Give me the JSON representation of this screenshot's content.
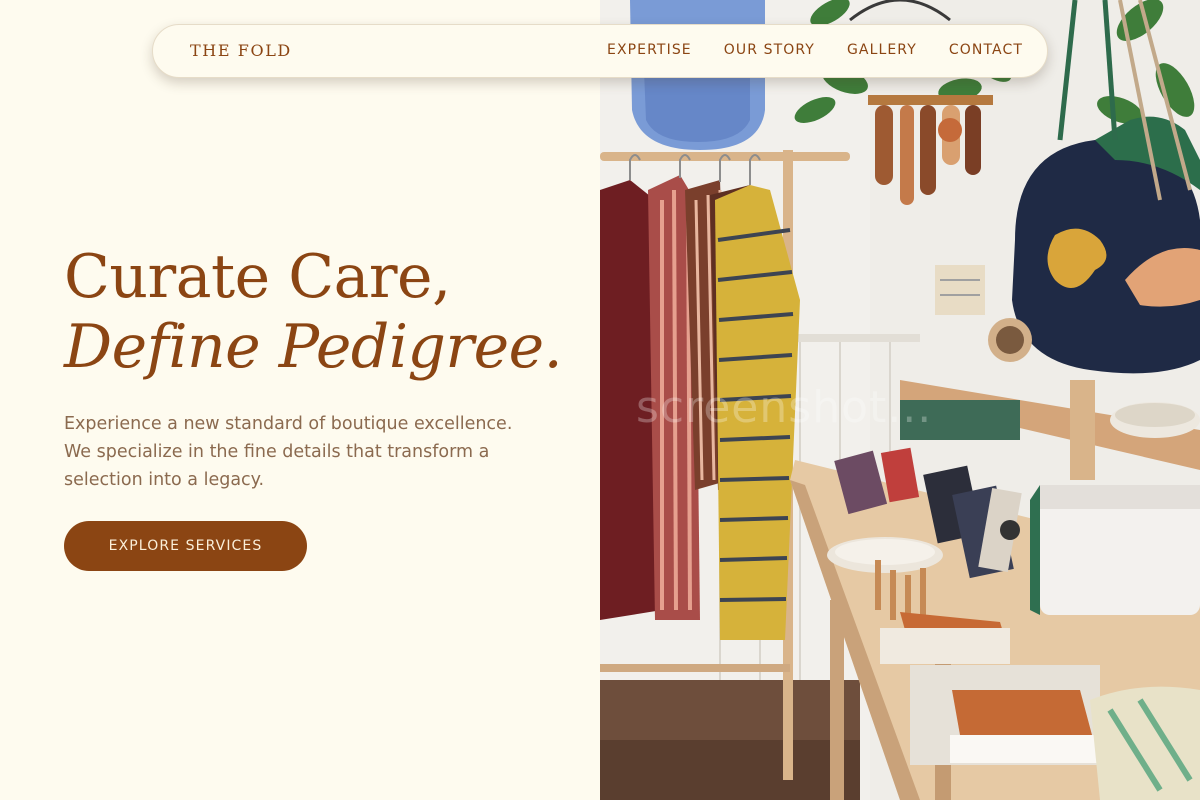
{
  "nav": {
    "brand": "THE FOLD",
    "links": [
      "EXPERTISE",
      "OUR STORY",
      "GALLERY",
      "CONTACT"
    ]
  },
  "hero": {
    "headline_line1": "Curate Care,",
    "headline_line2": "Define Pedigree.",
    "lead": "Experience a new standard of boutique excellence. We specialize in the fine details that transform a selection into a legacy.",
    "cta_label": "EXPLORE SERVICES"
  },
  "photo": {
    "watermark": "screenshot..."
  },
  "colors": {
    "background": "#FEFBEF",
    "brand_brown": "#8B4513",
    "body_text": "#8B6A4F",
    "button_text": "#FBEFD9"
  }
}
